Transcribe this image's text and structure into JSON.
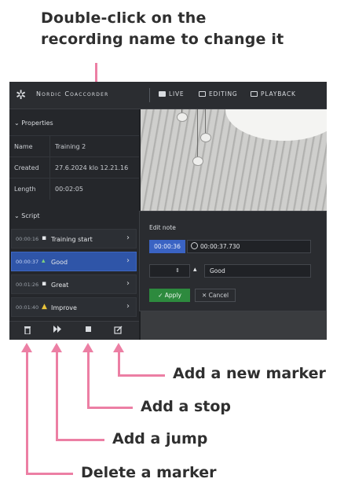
{
  "callouts": {
    "top_line1": "Double-click on the",
    "top_line2": "recording name to change it",
    "new_marker": "Add a new marker",
    "stop": "Add a stop",
    "jump": "Add a jump",
    "delete": "Delete a marker"
  },
  "app": {
    "brand": "Nordic Coaccorder",
    "nav": {
      "live": "LIVE",
      "editing": "EDITING",
      "playback": "PLAYBACK"
    }
  },
  "properties": {
    "heading": "⌄ Properties",
    "rows": [
      {
        "key": "Name",
        "value": "Training 2"
      },
      {
        "key": "Created",
        "value": "27.6.2024 klo 12.21.16"
      },
      {
        "key": "Length",
        "value": "00:02:05"
      }
    ]
  },
  "script": {
    "heading": "⌄ Script",
    "markers": [
      {
        "time": "00:00:16",
        "icon": "comment-icon",
        "label": "Training start",
        "selected": false
      },
      {
        "time": "00:00:37",
        "icon": "thumbs-up-icon",
        "label": "Good",
        "selected": true
      },
      {
        "time": "00:01:26",
        "icon": "comment-icon",
        "label": "Great",
        "selected": false
      },
      {
        "time": "00:01:40",
        "icon": "warning-icon",
        "label": "Improve",
        "selected": false
      }
    ]
  },
  "edit_note": {
    "title": "Edit note",
    "time_badge": "00:00:36",
    "time_value": "00:00:37.730",
    "label_value": "Good",
    "apply": "Apply",
    "cancel": "Cancel"
  },
  "colors": {
    "accent": "#3a63c3",
    "apply": "#2d8a3e",
    "annotation": "#ec7fa4"
  }
}
